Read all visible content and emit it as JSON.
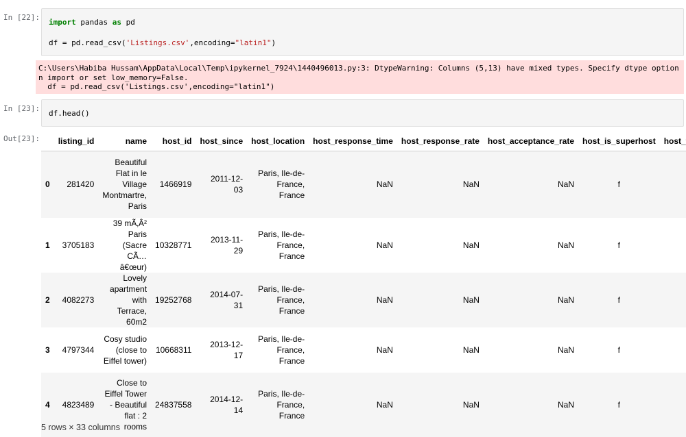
{
  "cells": [
    {
      "prompt": "In [22]:",
      "code": [
        [
          {
            "t": "import",
            "c": "kw"
          },
          {
            "t": " pandas "
          },
          {
            "t": "as",
            "c": "kw"
          },
          {
            "t": " pd"
          }
        ],
        [],
        [
          {
            "t": "df = pd.read_csv("
          },
          {
            "t": "'Listings.csv'",
            "c": "str"
          },
          {
            "t": ",encoding="
          },
          {
            "t": "\"latin1\"",
            "c": "str"
          },
          {
            "t": ")"
          }
        ]
      ],
      "warning": "C:\\Users\\Habiba Hussam\\AppData\\Local\\Temp\\ipykernel_7924\\1440496013.py:3: DtypeWarning: Columns (5,13) have mixed types. Specify dtype option o\nn import or set low_memory=False.\n  df = pd.read_csv('Listings.csv',encoding=\"latin1\")"
    },
    {
      "prompt": "In [23]:",
      "code_text": "df.head()",
      "out_prompt": "Out[23]:"
    }
  ],
  "table": {
    "columns": [
      "",
      "listing_id",
      "name",
      "host_id",
      "host_since",
      "host_location",
      "host_response_time",
      "host_response_rate",
      "host_acceptance_rate",
      "host_is_superhost",
      "host_total_listings_count"
    ],
    "rows": [
      {
        "index": "0",
        "listing_id": "281420",
        "name": [
          "Beautiful",
          "Flat in le",
          "Village",
          "Montmartre,",
          "Paris"
        ],
        "host_id": "1466919",
        "host_since": [
          "2011-12-",
          "03"
        ],
        "host_location": [
          "Paris, Ile-de-",
          "France,",
          "France"
        ],
        "host_response_time": "NaN",
        "host_response_rate": "NaN",
        "host_acceptance_rate": "NaN",
        "host_is_superhost": "f"
      },
      {
        "index": "1",
        "listing_id": "3705183",
        "name": [
          "39 mÃ‚Â²",
          "Paris (Sacre",
          "CÃ…â€œur)"
        ],
        "host_id": "10328771",
        "host_since": [
          "2013-11-",
          "29"
        ],
        "host_location": [
          "Paris, Ile-de-",
          "France,",
          "France"
        ],
        "host_response_time": "NaN",
        "host_response_rate": "NaN",
        "host_acceptance_rate": "NaN",
        "host_is_superhost": "f"
      },
      {
        "index": "2",
        "listing_id": "4082273",
        "name": [
          "Lovely",
          "apartment",
          "with Terrace,",
          "60m2"
        ],
        "host_id": "19252768",
        "host_since": [
          "2014-07-",
          "31"
        ],
        "host_location": [
          "Paris, Ile-de-",
          "France,",
          "France"
        ],
        "host_response_time": "NaN",
        "host_response_rate": "NaN",
        "host_acceptance_rate": "NaN",
        "host_is_superhost": "f"
      },
      {
        "index": "3",
        "listing_id": "4797344",
        "name": [
          "Cosy studio",
          "(close to",
          "Eiffel tower)"
        ],
        "host_id": "10668311",
        "host_since": [
          "2013-12-",
          "17"
        ],
        "host_location": [
          "Paris, Ile-de-",
          "France,",
          "France"
        ],
        "host_response_time": "NaN",
        "host_response_rate": "NaN",
        "host_acceptance_rate": "NaN",
        "host_is_superhost": "f"
      },
      {
        "index": "4",
        "listing_id": "4823489",
        "name": [
          "Close to",
          "Eiffel Tower",
          "- Beautiful",
          "flat : 2",
          "rooms"
        ],
        "host_id": "24837558",
        "host_since": [
          "2014-12-",
          "14"
        ],
        "host_location": [
          "Paris, Ile-de-",
          "France,",
          "France"
        ],
        "host_response_time": "NaN",
        "host_response_rate": "NaN",
        "host_acceptance_rate": "NaN",
        "host_is_superhost": "f"
      }
    ],
    "shape": "5 rows × 33 columns"
  },
  "colors": {
    "code_bg": "#f5f5f5",
    "warning_bg": "#ffdddd",
    "keyword": "#008000",
    "string": "#ba2121",
    "prompt": "#5f6368"
  }
}
